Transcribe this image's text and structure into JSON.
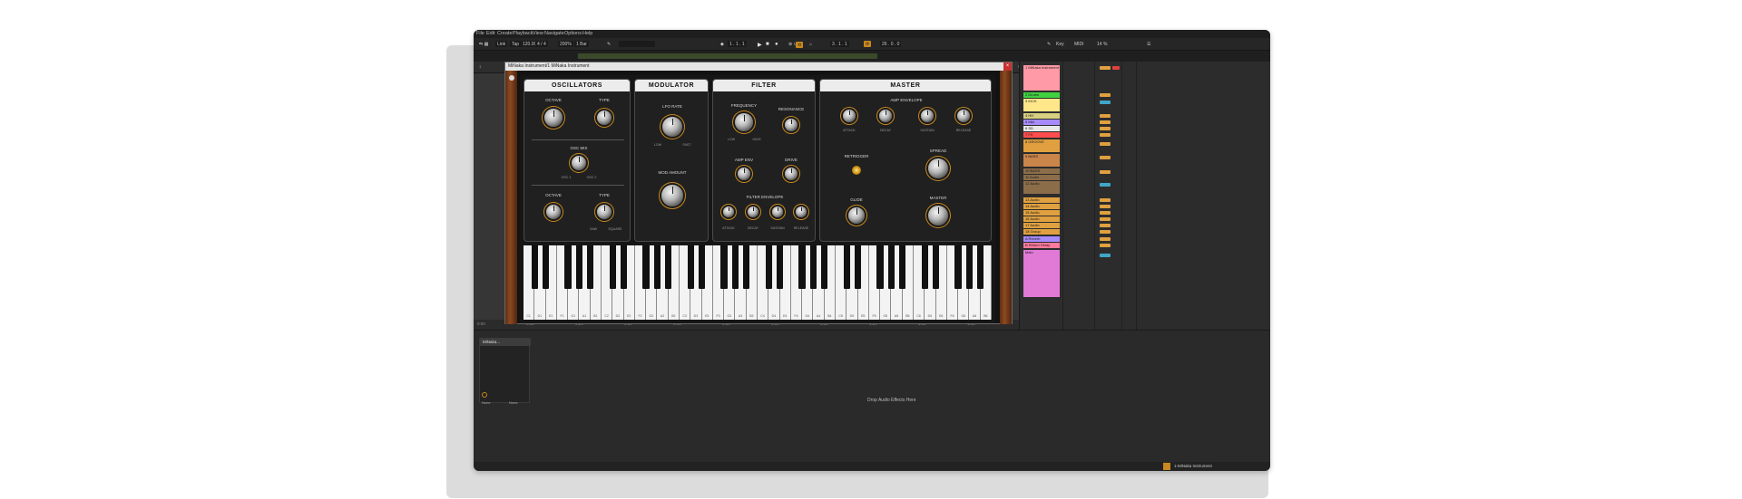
{
  "menu": [
    "File",
    "Edit",
    "Create",
    "Playback",
    "View",
    "Navigate",
    "Options",
    "Help"
  ],
  "toolbar": {
    "link": "Link",
    "tap": "Tap",
    "tempo": "120.00",
    "signature": "4 / 4",
    "zoom": "200%",
    "quant": "1 Bar",
    "position": "1 . 1 . 1",
    "loop_start": "3 . 1 . 1",
    "loop_len": "26 . 0 . 0",
    "key": "Key",
    "midi": "MIDI",
    "cpu": "14 %"
  },
  "ruler_marks": [
    "1",
    "5",
    "9",
    "13",
    "17",
    "21",
    "25",
    "29",
    "33",
    "37",
    "41",
    "45",
    "49",
    "53",
    "57",
    "61",
    "65",
    "69",
    "73",
    "77"
  ],
  "bottom_ruler": [
    "0:00",
    "0:10",
    "0:20",
    "0:30",
    "0:40",
    "0:50",
    "1:00",
    "1:10",
    "1:20",
    "1:30",
    "1:40",
    "1:50",
    "2:00"
  ],
  "plugin": {
    "title": "MiNaka Instrument/1 MiNaka Instrument",
    "close": "×",
    "sections": {
      "osc": "OSCILLATORS",
      "mod": "MODULATOR",
      "filter": "FILTER",
      "master": "MASTER"
    },
    "labels": {
      "octave1": "OCTAVE",
      "type1": "TYPE",
      "osc_mix": "OSC MIX",
      "octave2": "OCTAVE",
      "type2": "TYPE",
      "lfo_rate": "LFO RATE",
      "mod_amount": "MOD AMOUNT",
      "frequency": "FREQUENCY",
      "resonance": "RESONANCE",
      "amp_env": "AMP ENV",
      "drive": "DRIVE",
      "filter_env": "FILTER ENVELOPE",
      "attack_f": "ATTACK",
      "decay_f": "DECAY",
      "sustain_f": "SUSTAIN",
      "release_f": "RELEASE",
      "amp_envelope": "AMP ENVELOPE",
      "attack": "ATTACK",
      "decay": "DECAY",
      "sustain": "SUSTAIN",
      "release": "RELEASE",
      "retrigger": "RETRIGGER",
      "spread": "SPREAD",
      "glide": "GLIDE",
      "master": "MASTER"
    },
    "sub": {
      "saw": "SAW",
      "square": "SQUARE",
      "osc1": "OSC 1",
      "osc2": "OSC 2",
      "low": "LOW",
      "high": "HIGH",
      "fast": "FAST"
    },
    "white_keys": [
      "C1",
      "D1",
      "E1",
      "F1",
      "G1",
      "A1",
      "B1",
      "C2",
      "D2",
      "E2",
      "F2",
      "G2",
      "A2",
      "B2",
      "C3",
      "D3",
      "E3",
      "F3",
      "G3",
      "A3",
      "B3",
      "C4",
      "D4",
      "E4",
      "F4",
      "G4",
      "A4",
      "B4",
      "C5",
      "D5",
      "E5",
      "F5",
      "G5",
      "A5",
      "B5",
      "C6",
      "D6",
      "E6",
      "F6",
      "G6",
      "A6",
      "B6"
    ]
  },
  "mixer_tracks": [
    {
      "name": "1 MiNaka Instrument",
      "color": "#ff9aa6"
    },
    {
      "name": "2 Drums",
      "color": "#3fd13f"
    },
    {
      "name": "3 KICK",
      "color": "#ffe78a"
    },
    {
      "name": "4 HH",
      "color": "#c4c4ff"
    },
    {
      "name": "5 Mid",
      "color": "#a78bfa"
    },
    {
      "name": "6 SD",
      "color": "#e8e8e8"
    },
    {
      "name": "7 FX",
      "color": "#ff4d4d"
    },
    {
      "name": "8 GROOVE",
      "color": "#e0a040"
    },
    {
      "name": "9 BASS",
      "color": "#c9854a"
    },
    {
      "name": "10 BASS",
      "color": "#8c6d4a"
    },
    {
      "name": "11 Audio",
      "color": "#8c6d4a"
    },
    {
      "name": "12 Audio",
      "color": "#8c6d4a"
    },
    {
      "name": "13 Audio",
      "color": "#e0a040"
    },
    {
      "name": "14 Audio",
      "color": "#e0a040"
    },
    {
      "name": "15 Audio",
      "color": "#e0a040"
    },
    {
      "name": "16 Audio",
      "color": "#e0a040"
    },
    {
      "name": "17 Audio",
      "color": "#e0a040"
    },
    {
      "name": "18 Group",
      "color": "#e0a040"
    },
    {
      "name": "A Reverb",
      "color": "#a78bfa"
    },
    {
      "name": "B Return Delay",
      "color": "#ff7a9c"
    },
    {
      "name": "Main",
      "color": "#e07ad6"
    }
  ],
  "device": {
    "tile_title": "MiNaka...",
    "tile_left": "None",
    "tile_right": "None",
    "drop_hint": "Drop Audio Effects Here",
    "status_track": "1-MiNaka Instrument"
  },
  "colors": {
    "accent": "#c8891e",
    "midi_green": "#3fd13f"
  }
}
